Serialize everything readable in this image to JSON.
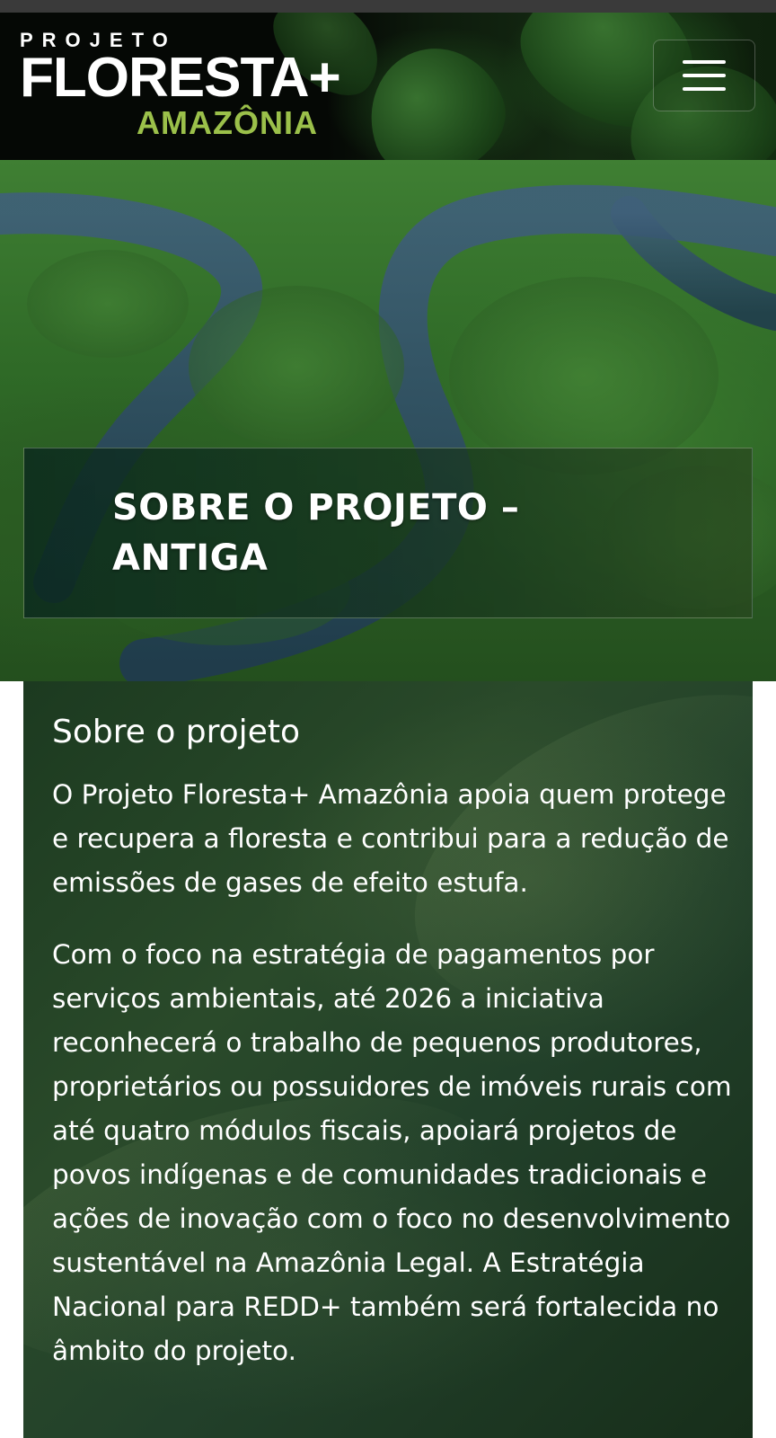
{
  "header": {
    "logo": {
      "top_text": "PROJETO",
      "main_text": "FLORESTA+",
      "sub_text": "AMAZÔNIA"
    },
    "menu_button_icon": "hamburger-menu-icon"
  },
  "hero": {
    "title": "SOBRE O PROJETO – ANTIGA"
  },
  "content": {
    "heading": "Sobre o projeto",
    "paragraphs": [
      "O Projeto Floresta+ Amazônia apoia quem protege e recupera a floresta e contribui para a redução de emissões de gases de efeito estufa.",
      "Com o foco na estratégia de pagamentos por serviços ambientais, até 2026 a iniciativa reconhecerá o trabalho de pequenos produtores, proprietários ou possuidores de imóveis rurais com até quatro módulos fiscais, apoiará projetos de povos indígenas e de comunidades tradicionais e ações de inovação com o foco no desenvolvimento sustentável na Amazônia Legal. A Estratégia Nacional para REDD+ também será fortalecida no âmbito do projeto."
    ]
  },
  "colors": {
    "logo_accent": "#9bc04a",
    "header_bg": "#050805",
    "content_bg": "#22402a",
    "text": "#ffffff"
  }
}
